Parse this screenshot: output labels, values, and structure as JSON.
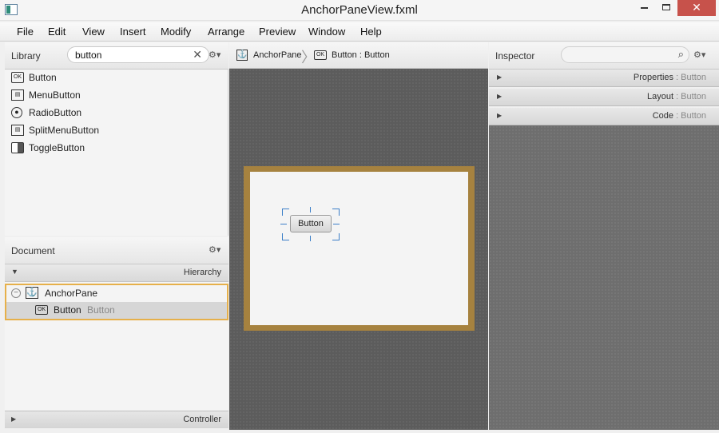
{
  "window": {
    "title": "AnchorPaneView.fxml",
    "close_glyph": "✕"
  },
  "menu": [
    "File",
    "Edit",
    "View",
    "Insert",
    "Modify",
    "Arrange",
    "Preview",
    "Window",
    "Help"
  ],
  "library": {
    "label": "Library",
    "search_value": "button",
    "clear_glyph": "✕",
    "items": [
      {
        "label": "Button",
        "icon": "ok-button-icon"
      },
      {
        "label": "MenuButton",
        "icon": "menu-button-icon"
      },
      {
        "label": "RadioButton",
        "icon": "radio-button-icon"
      },
      {
        "label": "SplitMenuButton",
        "icon": "split-menu-button-icon"
      },
      {
        "label": "ToggleButton",
        "icon": "toggle-button-icon"
      }
    ]
  },
  "document": {
    "label": "Document",
    "hierarchy_label": "Hierarchy",
    "tree": [
      {
        "label": "AnchorPane",
        "sub": ""
      },
      {
        "label": "Button",
        "sub": "Button"
      }
    ],
    "controller_label": "Controller"
  },
  "breadcrumb": {
    "first": "AnchorPane",
    "second": "Button : Button"
  },
  "canvas": {
    "button_label": "Button",
    "anchor_border_color": "#a6823f",
    "selection_handle_color": "#3c7fc8"
  },
  "inspector": {
    "label": "Inspector",
    "sections": [
      {
        "name": "Properties",
        "sub": " : Button"
      },
      {
        "name": "Layout",
        "sub": " : Button"
      },
      {
        "name": "Code",
        "sub": " : Button"
      }
    ]
  },
  "icon_text": {
    "ok": "OK",
    "gear": "⚙▾",
    "expand": "▶",
    "collapse": "▼",
    "minus": "−",
    "anchor": "⚓",
    "search": "⌕"
  }
}
